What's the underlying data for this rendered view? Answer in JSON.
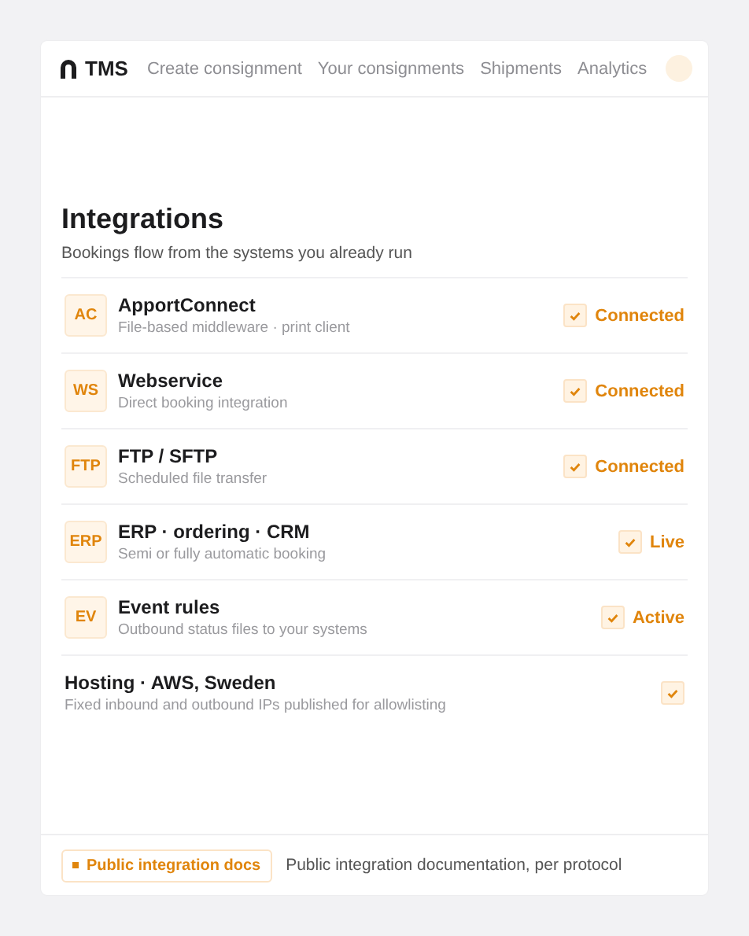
{
  "header": {
    "brand": "TMS",
    "nav": [
      {
        "label": "Create consignment",
        "selected": false
      },
      {
        "label": "Your consignments",
        "selected": false
      },
      {
        "label": "Shipments",
        "selected": false
      },
      {
        "label": "Analytics",
        "selected": false
      }
    ]
  },
  "title": "Integrations",
  "subtitle": "Bookings flow from the systems you already run",
  "integrations": [
    {
      "kind": "tile",
      "code": "AC",
      "name": "ApportConnect",
      "description": "File-based middleware · print client",
      "checked": true,
      "status": "Connected"
    },
    {
      "kind": "tile",
      "code": "WS",
      "name": "Webservice",
      "description": "Direct booking integration",
      "checked": true,
      "status": "Connected"
    },
    {
      "kind": "tile",
      "code": "FTP",
      "name": "FTP / SFTP",
      "description": "Scheduled file transfer",
      "checked": true,
      "status": "Connected"
    },
    {
      "kind": "tile",
      "code": "ERP",
      "name": "ERP · ordering · CRM",
      "description": "Semi or fully automatic booking",
      "checked": true,
      "status": "Live"
    },
    {
      "kind": "tile",
      "code": "EV",
      "name": "Event rules",
      "description": "Outbound status files to your systems",
      "checked": true,
      "status": "Active"
    },
    {
      "kind": "plain",
      "name": "Hosting · AWS, Sweden",
      "description": "Fixed inbound and outbound IPs published for allowlisting",
      "checked": true
    }
  ],
  "footer": {
    "docs_button": "Public integration docs",
    "note": "Public integration documentation, per protocol"
  }
}
